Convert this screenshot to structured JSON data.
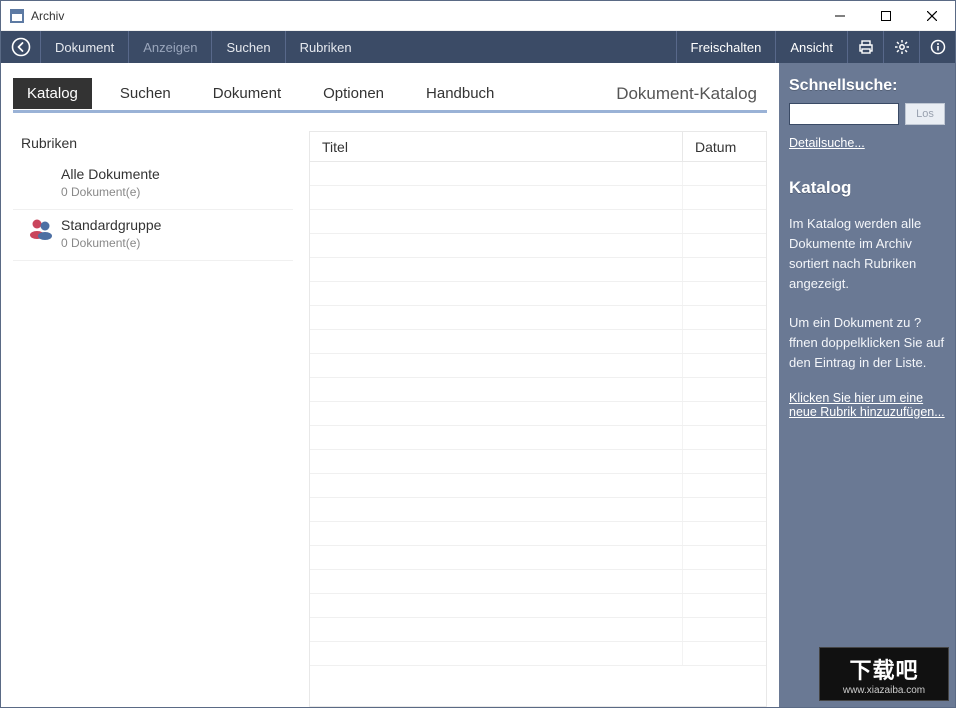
{
  "window": {
    "title": "Archiv"
  },
  "toolbar": {
    "items": [
      "Dokument",
      "Anzeigen",
      "Suchen",
      "Rubriken"
    ],
    "right": {
      "freischalten": "Freischalten",
      "ansicht": "Ansicht"
    }
  },
  "tabs": {
    "items": [
      "Katalog",
      "Suchen",
      "Dokument",
      "Optionen",
      "Handbuch"
    ],
    "active": 0,
    "heading": "Dokument-Katalog"
  },
  "rubriken": {
    "header": "Rubriken",
    "items": [
      {
        "name": "Alle Dokumente",
        "count": "0 Dokument(e)",
        "icon": "none"
      },
      {
        "name": "Standardgruppe",
        "count": "0 Dokument(e)",
        "icon": "group"
      }
    ]
  },
  "table": {
    "columns": {
      "titel": "Titel",
      "datum": "Datum"
    },
    "rows": []
  },
  "sidebar": {
    "quick_search_title": "Schnellsuche:",
    "search_value": "",
    "los_label": "Los",
    "detail_link": "Detailsuche...",
    "section_title": "Katalog",
    "para1": "Im Katalog werden alle Dokumente im Archiv sortiert nach Rubriken angezeigt.",
    "para2": "Um ein Dokument zu ?ffnen doppelklicken Sie auf den Eintrag in der Liste.",
    "add_link": "Klicken Sie hier um eine neue Rubrik hinzuzufügen..."
  },
  "watermark": {
    "big": "下载吧",
    "small": "www.xiazaiba.com"
  }
}
